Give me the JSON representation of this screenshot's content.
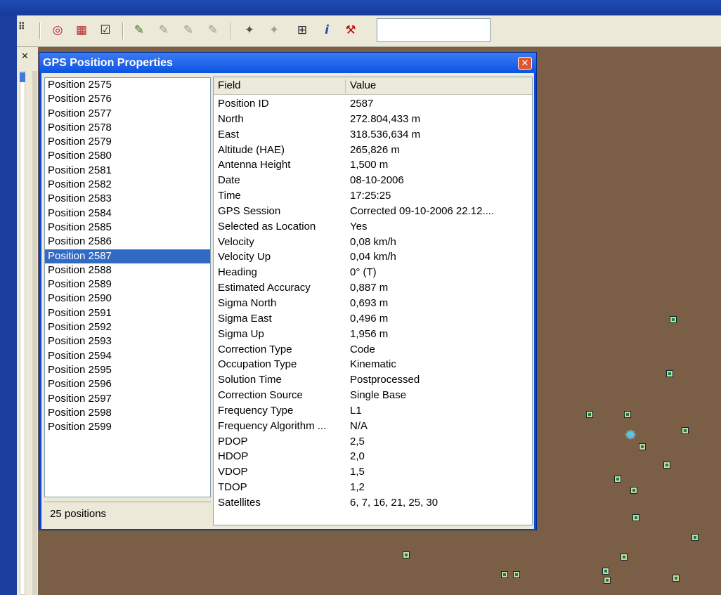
{
  "window": {
    "title": "GPS Position Properties",
    "close_glyph": "✕"
  },
  "toolbar": {
    "icons": [
      "grip-icon",
      "target-icon",
      "brick-wall-icon",
      "clipboard-check-icon",
      "pen-check-icon",
      "disabled-pen-icon",
      "disabled-pen-icon",
      "disabled-pen-icon",
      "satellite-icon",
      "disabled-satellite-icon",
      "add-point-icon",
      "info-icon",
      "tools-icon"
    ],
    "search_value": ""
  },
  "side_panel": {
    "close_glyph": "✕"
  },
  "positions": {
    "items": [
      "Position 2575",
      "Position 2576",
      "Position 2577",
      "Position 2578",
      "Position 2579",
      "Position 2580",
      "Position 2581",
      "Position 2582",
      "Position 2583",
      "Position 2584",
      "Position 2585",
      "Position 2586",
      "Position 2587",
      "Position 2588",
      "Position 2589",
      "Position 2590",
      "Position 2591",
      "Position 2592",
      "Position 2593",
      "Position 2594",
      "Position 2595",
      "Position 2596",
      "Position 2597",
      "Position 2598",
      "Position 2599"
    ],
    "selected": "Position 2587",
    "status": "25 positions"
  },
  "properties": {
    "columns": [
      "Field",
      "Value"
    ],
    "rows": [
      [
        "Position ID",
        "2587"
      ],
      [
        "North",
        "272.804,433 m"
      ],
      [
        "East",
        "318.536,634 m"
      ],
      [
        "Altitude (HAE)",
        "265,826 m"
      ],
      [
        "Antenna Height",
        "1,500 m"
      ],
      [
        "Date",
        "08-10-2006"
      ],
      [
        "Time",
        "17:25:25"
      ],
      [
        "GPS Session",
        "Corrected 09-10-2006 22.12...."
      ],
      [
        "Selected as Location",
        "Yes"
      ],
      [
        "Velocity",
        "0,08 km/h"
      ],
      [
        "Velocity Up",
        "0,04 km/h"
      ],
      [
        "Heading",
        "0° (T)"
      ],
      [
        "Estimated Accuracy",
        "0,887 m"
      ],
      [
        "Sigma North",
        "0,693 m"
      ],
      [
        "Sigma East",
        "0,496 m"
      ],
      [
        "Sigma Up",
        "1,956 m"
      ],
      [
        "Correction Type",
        "Code"
      ],
      [
        "Occupation Type",
        "Kinematic"
      ],
      [
        "Solution Time",
        "Postprocessed"
      ],
      [
        "Correction Source",
        "Single Base"
      ],
      [
        "Frequency Type",
        "L1"
      ],
      [
        "Frequency Algorithm ...",
        "N/A"
      ],
      [
        "PDOP",
        "2,5"
      ],
      [
        "HDOP",
        "2,0"
      ],
      [
        "VDOP",
        "1,5"
      ],
      [
        "TDOP",
        "1,2"
      ],
      [
        "Satellites",
        "6, 7, 16, 21, 25, 30"
      ]
    ]
  },
  "map": {
    "background_color": "#7a5f46",
    "marker_count": 21,
    "selected_marker_icon": "gps-antenna-icon"
  }
}
